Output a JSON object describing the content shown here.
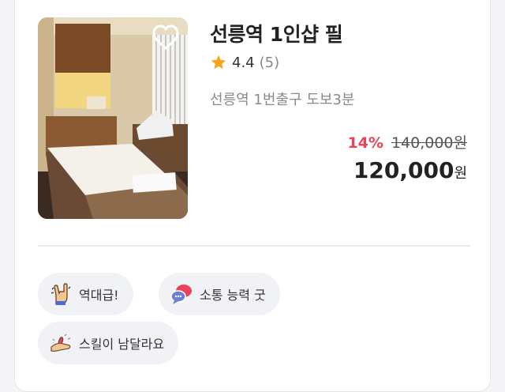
{
  "product": {
    "title": "선릉역 1인샵 필",
    "rating": "4.4",
    "review_count": "(5)",
    "location": "선릉역 1번출구 도보3분",
    "discount": "14%",
    "original_price": "140,000원",
    "price": "120,000",
    "price_unit": "원"
  },
  "icons": {
    "favorite": "heart-outline-icon",
    "rating": "star-icon"
  },
  "colors": {
    "discount": "#e9435a",
    "star": "#f7a51c",
    "chip_bg": "#f1f2f5"
  },
  "tags": [
    {
      "label": "역대급!",
      "icon": "rock-hand-icon"
    },
    {
      "label": "소통 능력 굿",
      "icon": "chat-bubbles-icon"
    },
    {
      "label": "스킬이 남달라요",
      "icon": "massage-hand-icon"
    }
  ]
}
